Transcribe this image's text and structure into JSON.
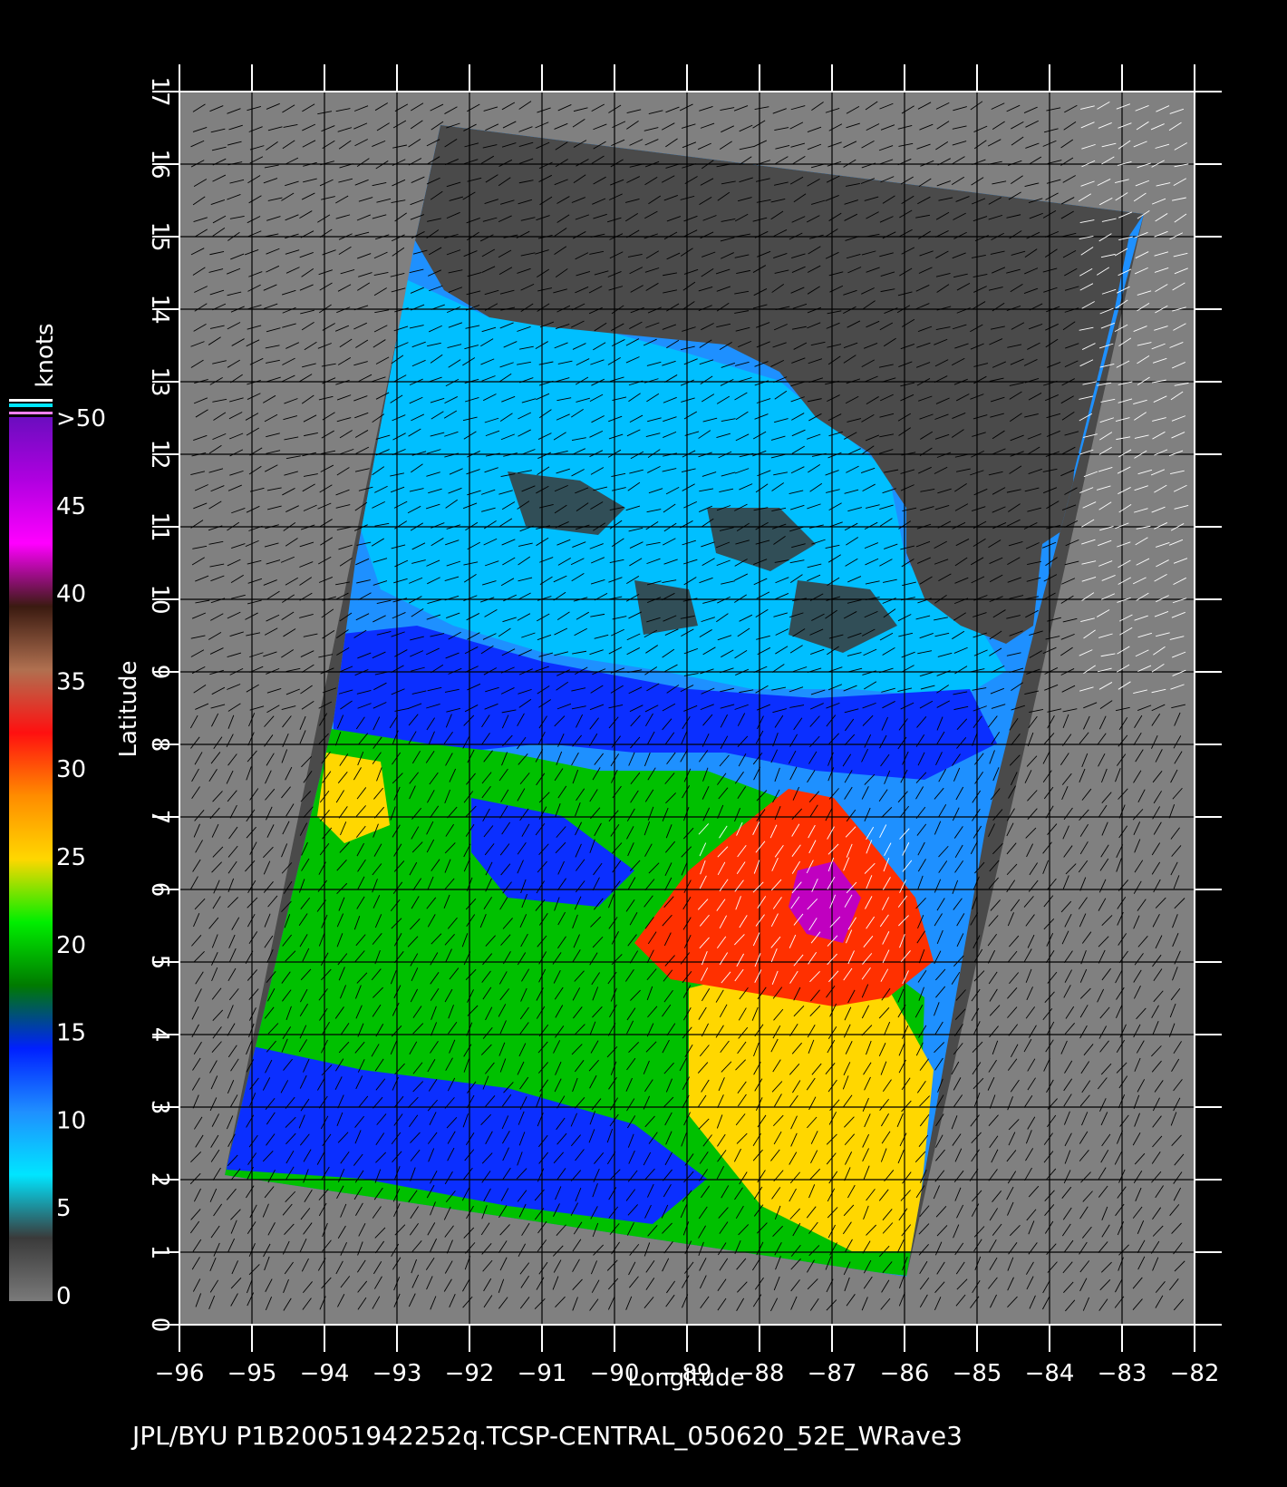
{
  "map": {
    "lon_ticks": [
      -96,
      -95,
      -94,
      -93,
      -92,
      -91,
      -90,
      -89,
      -88,
      -87,
      -86,
      -85,
      -84,
      -83,
      -82
    ],
    "lat_ticks": [
      0,
      1,
      2,
      3,
      4,
      5,
      6,
      7,
      8,
      9,
      10,
      11,
      12,
      13,
      14,
      15,
      16,
      17
    ],
    "lon_range": [
      -96,
      -82
    ],
    "lat_range": [
      0,
      17
    ],
    "xlabel": "Longitude",
    "ylabel": "Latitude",
    "footer": "JPL/BYU  P1B20051942252q.TCSP-CENTRAL_050620_52E_WRave3",
    "background_color": "#808080",
    "land_color": "#4a4a4a",
    "grid_color": "#000000"
  },
  "legend": {
    "unit": "knots",
    "labels": [
      ">50",
      "45",
      "40",
      "35",
      "30",
      "25",
      "20",
      "15",
      "10",
      "5",
      "0"
    ],
    "stops": [
      {
        "color": "#6a0dbf"
      },
      {
        "color": "#b000e0"
      },
      {
        "color": "#ff00ff"
      },
      {
        "color": "#3a1a10"
      },
      {
        "color": "#b07050"
      },
      {
        "color": "#ff1010"
      },
      {
        "color": "#ff8c00"
      },
      {
        "color": "#ffd700"
      },
      {
        "color": "#00ee00"
      },
      {
        "color": "#007a00"
      },
      {
        "color": "#0020ff"
      },
      {
        "color": "#1f8fff"
      },
      {
        "color": "#00e5ff"
      },
      {
        "color": "#3a3a3a"
      },
      {
        "color": "#7a7a7a"
      }
    ]
  },
  "swath": {
    "wind_colors": {
      "calm": "#1e90ff",
      "light": "#00bfff",
      "moderate": "#0b2fff",
      "fresh": "#00c000",
      "strong": "#ffd700",
      "gale": "#ff3000",
      "storm": "#c000c0"
    }
  }
}
